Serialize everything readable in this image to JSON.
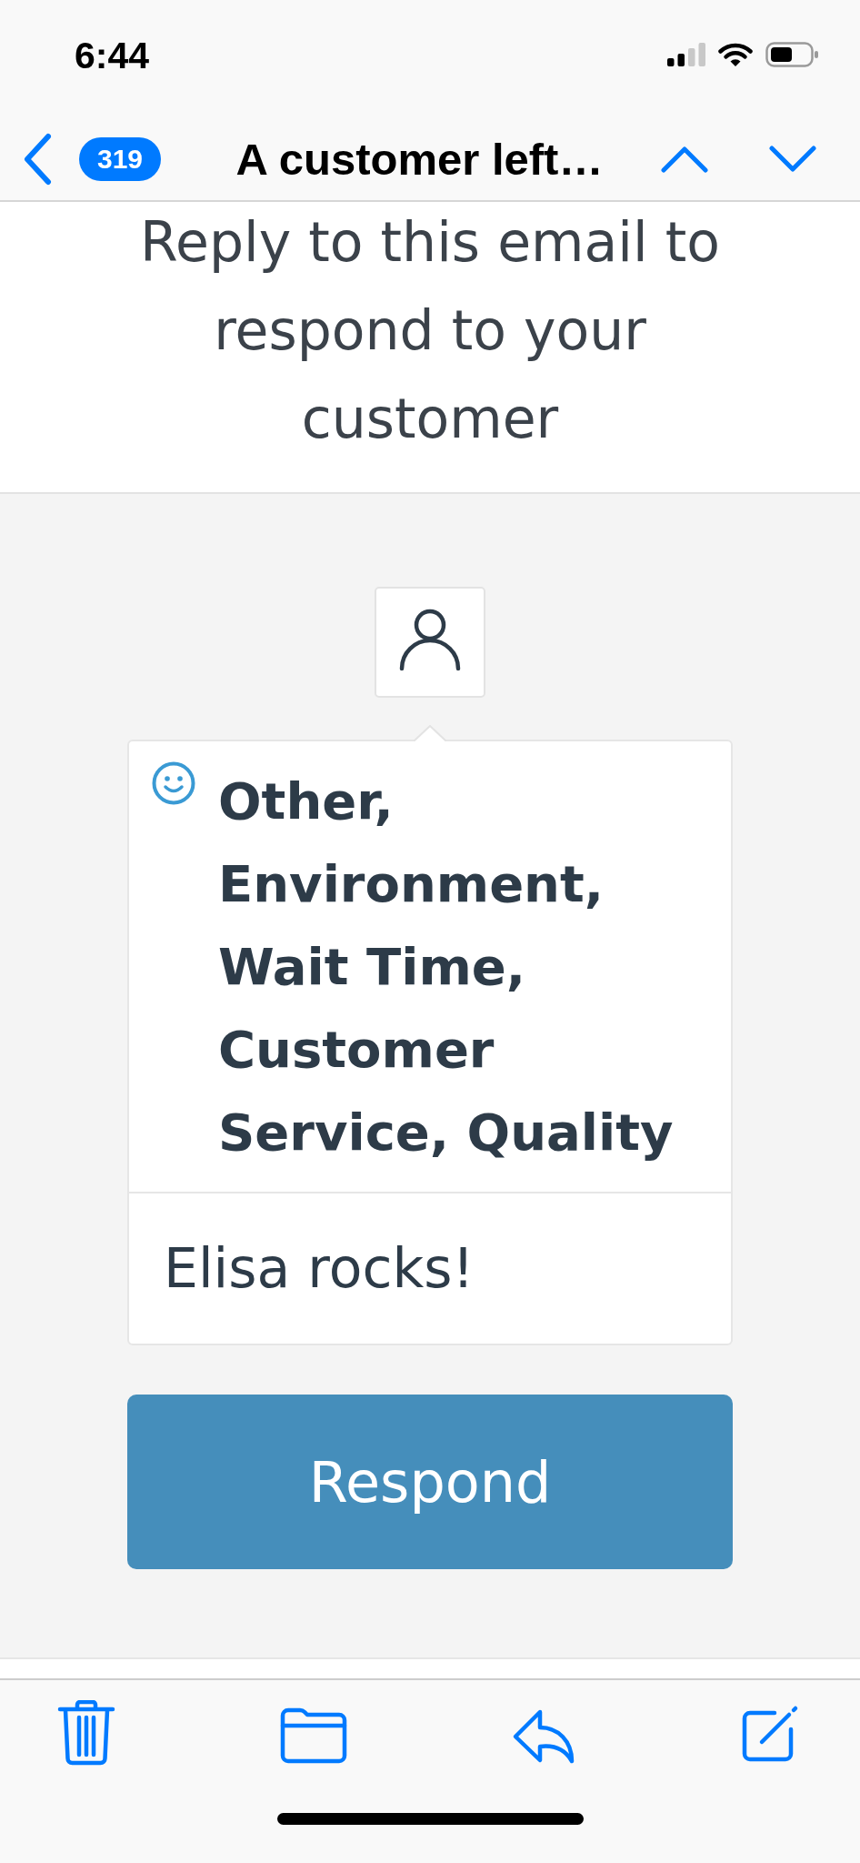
{
  "status_bar": {
    "time": "6:44"
  },
  "nav_bar": {
    "unread_count": "319",
    "title": "A customer left…"
  },
  "email": {
    "intro": "Reply to this email to respond to your customer",
    "feedback_card": {
      "categories": "Other, Environment, Wait Time, Customer Service, Quality",
      "comment": "Elisa rocks!"
    },
    "button": "Respond"
  }
}
